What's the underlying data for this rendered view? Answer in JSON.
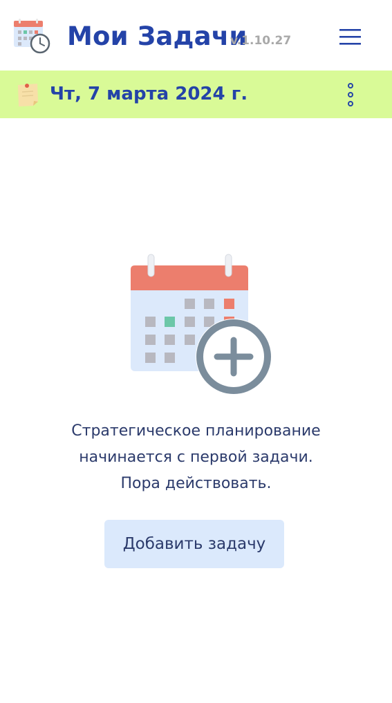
{
  "header": {
    "title": "Мои Задачи",
    "version": "v.1.10.27",
    "logo_icon": "calendar-clock-icon",
    "menu_icon": "hamburger-menu-icon"
  },
  "date_bar": {
    "date": "Чт, 7 марта 2024 г.",
    "note_icon": "sticky-note-icon",
    "more_icon": "vertical-dots-icon",
    "background": "#d9fa97"
  },
  "empty_state": {
    "illustration": "calendar-add-icon",
    "message_lines": [
      "Стратегическое планирование",
      "начинается с первой задачи.",
      "Пора действовать."
    ],
    "add_button_label": "Добавить задачу"
  },
  "colors": {
    "accent": "#2443a8",
    "text": "#2b3a6b",
    "version": "#a9a9a9",
    "button_bg": "#dbe9fc",
    "calendar_header": "#ec7e6d",
    "calendar_body": "#dce9fb",
    "plus_circle": "#7b8d9c"
  }
}
